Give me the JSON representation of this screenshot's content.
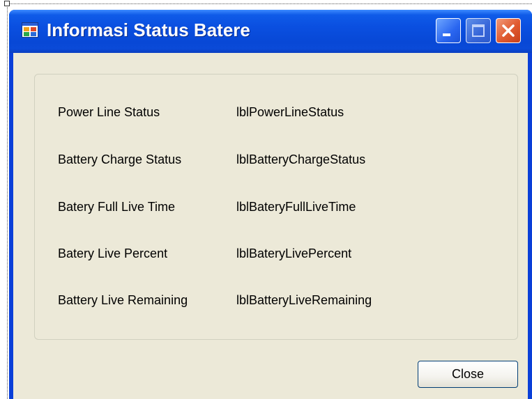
{
  "window": {
    "title": "Informasi Status Batere",
    "icon": "app-window-icon",
    "controls": [
      "minimize-icon",
      "maximize-icon",
      "close-icon"
    ],
    "title_color": "#ffffff",
    "titlebar_color": "#0a4fe0",
    "client_color": "#ece9d8"
  },
  "rows": [
    {
      "label": "Power Line Status",
      "value": "lblPowerLineStatus"
    },
    {
      "label": "Battery Charge Status",
      "value": "lblBatteryChargeStatus"
    },
    {
      "label": "Batery Full Live Time",
      "value": "lblBateryFullLiveTime"
    },
    {
      "label": "Batery Live Percent",
      "value": "lblBateryLivePercent"
    },
    {
      "label": "Battery Live Remaining",
      "value": "lblBatteryLiveRemaining"
    }
  ],
  "buttons": {
    "close_label": "Close"
  }
}
